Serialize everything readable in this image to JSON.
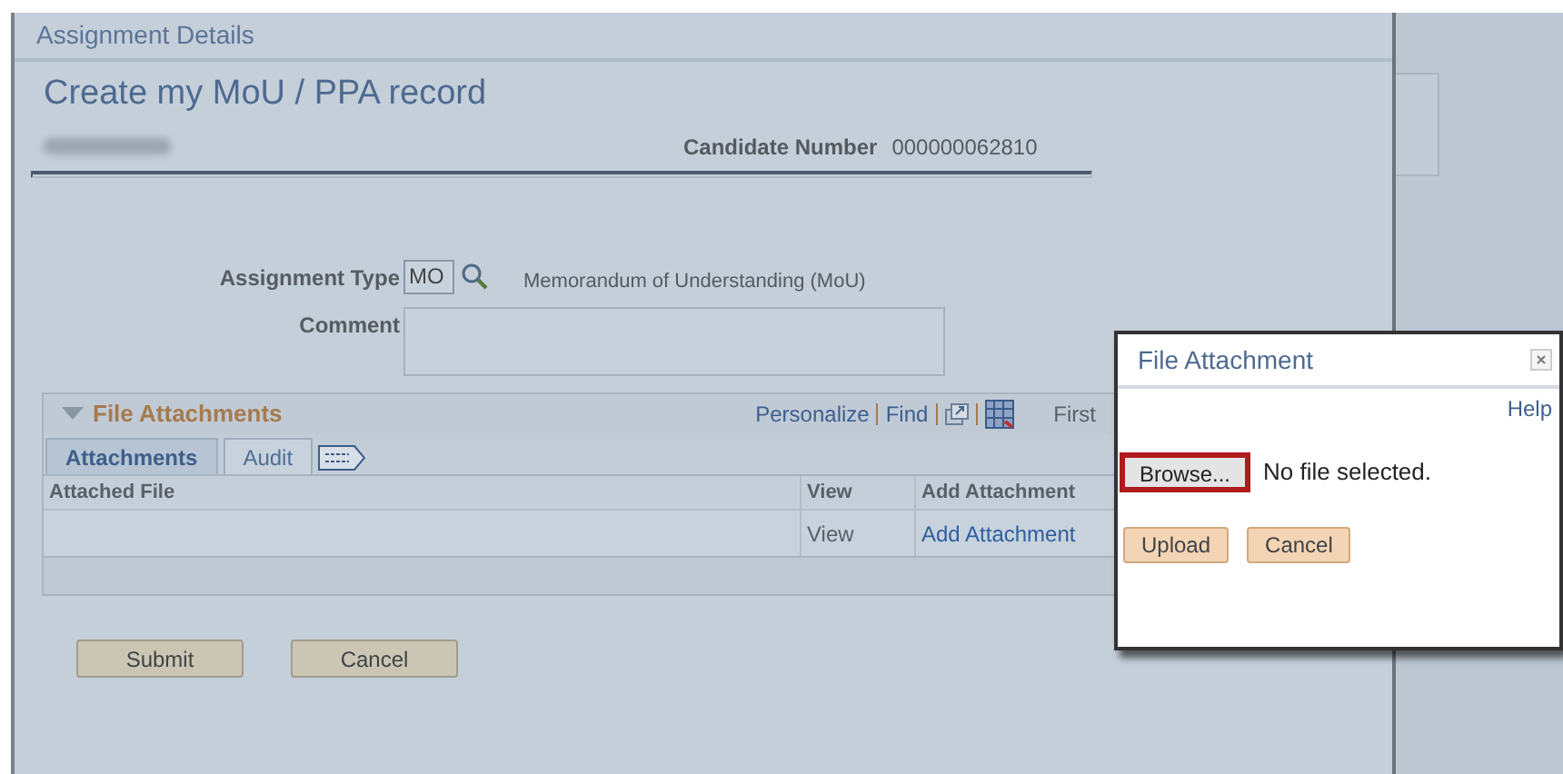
{
  "window": {
    "title": "Assignment Details"
  },
  "page_title": "Create my MoU / PPA record",
  "candidate": {
    "label": "Candidate Number",
    "value": "000000062810"
  },
  "fields": [
    {
      "label": "Assignment Type",
      "kind": "lookup",
      "value": "MO",
      "description": "Memorandum of Understanding (MoU)"
    },
    {
      "label": "Comment",
      "kind": "textarea"
    }
  ],
  "grid": {
    "title": "File Attachments",
    "expanded": true,
    "toolbar": [
      "Personalize",
      "Find"
    ],
    "navigation": "First",
    "tabs": [
      {
        "label": "Attachments",
        "selected": true
      },
      {
        "label": "Audit",
        "selected": false
      }
    ],
    "columns": [
      "Attached File",
      "View",
      "Add Attachment"
    ],
    "rows": [
      {
        "view": "View",
        "add": "Add Attachment"
      }
    ]
  },
  "buttons": [
    "Submit",
    "Cancel"
  ],
  "dialog": {
    "title": "File Attachment",
    "help": "Help",
    "browse": {
      "label": "Browse...",
      "highlighted": true
    },
    "file_status": "No file selected.",
    "buttons": [
      "Upload",
      "Cancel"
    ]
  }
}
